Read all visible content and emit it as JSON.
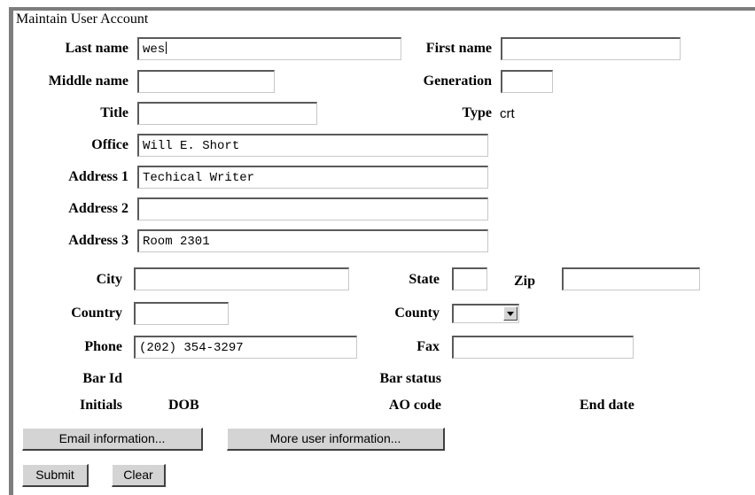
{
  "form": {
    "title": "Maintain User Account",
    "labels": {
      "last_name": "Last name",
      "first_name": "First name",
      "middle_name": "Middle name",
      "generation": "Generation",
      "title": "Title",
      "type": "Type",
      "office": "Office",
      "address1": "Address 1",
      "address2": "Address 2",
      "address3": "Address 3",
      "city": "City",
      "state": "State",
      "zip": "Zip",
      "country": "Country",
      "county": "County",
      "phone": "Phone",
      "fax": "Fax",
      "bar_id": "Bar Id",
      "bar_status": "Bar status",
      "initials": "Initials",
      "dob": "DOB",
      "ao_code": "AO code",
      "end_date": "End date"
    },
    "values": {
      "last_name": "wes",
      "first_name": "",
      "middle_name": "",
      "generation": "",
      "title": "",
      "type": "crt",
      "office": "Will E. Short",
      "address1": "Techical Writer",
      "address2": "",
      "address3": "Room 2301",
      "city": "",
      "state": "",
      "zip": "",
      "country": "",
      "county": "",
      "phone": "(202) 354-3297",
      "fax": ""
    }
  },
  "buttons": {
    "email_info": "Email information...",
    "more_info": "More user information...",
    "submit": "Submit",
    "clear": "Clear"
  }
}
